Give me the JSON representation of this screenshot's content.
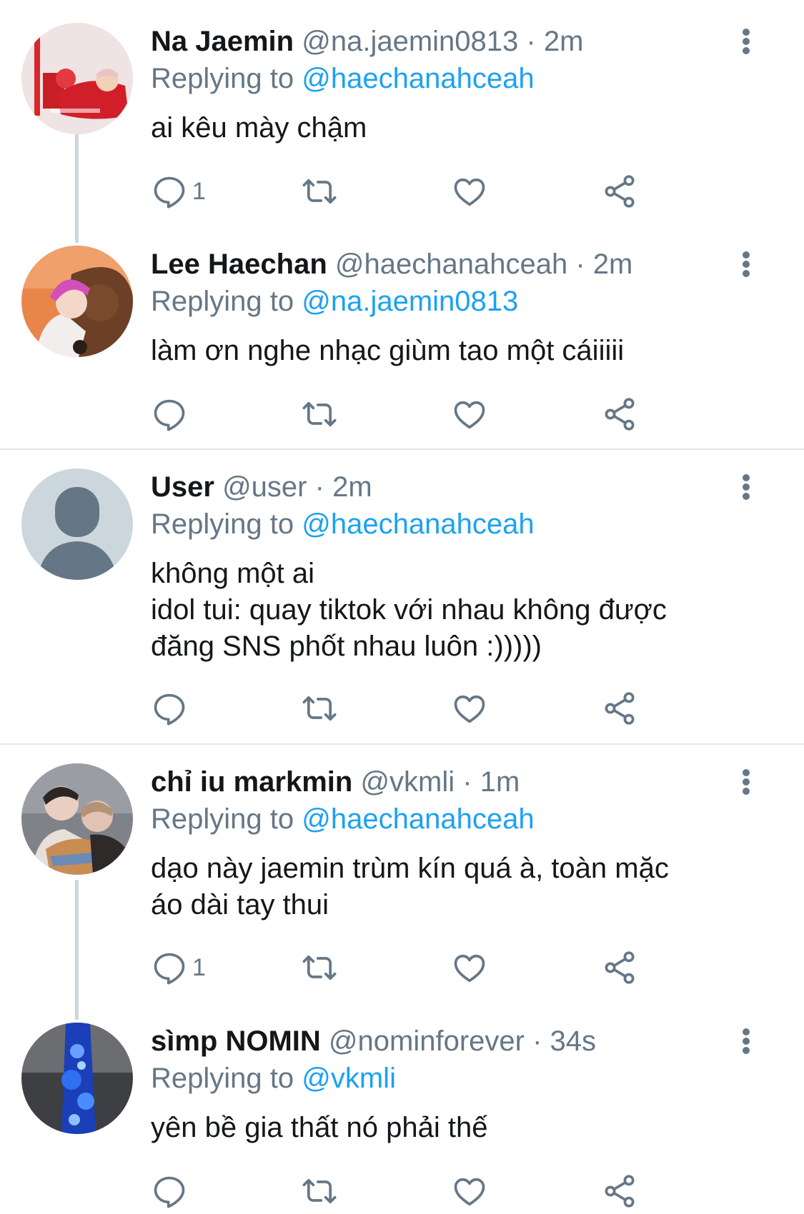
{
  "tweets": [
    {
      "name": "Na Jaemin",
      "handle": "@na.jaemin0813",
      "time": "2m",
      "replying_prefix": "Replying to",
      "replying_to": "@haechanahceah",
      "lines": [
        "ai kêu mày chậm"
      ],
      "reply_count": "1"
    },
    {
      "name": "Lee Haechan",
      "handle": "@haechanahceah",
      "time": "2m",
      "replying_prefix": "Replying to",
      "replying_to": "@na.jaemin0813",
      "lines": [
        "làm ơn nghe nhạc giùm tao một cáiiiii"
      ],
      "reply_count": ""
    },
    {
      "name": "User",
      "handle": "@user",
      "time": "2m",
      "replying_prefix": "Replying to",
      "replying_to": "@haechanahceah",
      "lines": [
        "không một ai",
        "idol tui: quay tiktok với nhau không được",
        "đăng SNS phốt nhau luôn :)))))"
      ],
      "reply_count": ""
    },
    {
      "name": "chỉ iu markmin",
      "handle": "@vkmli",
      "time": "1m",
      "replying_prefix": "Replying to",
      "replying_to": "@haechanahceah",
      "lines": [
        "dạo này jaemin trùm kín quá à, toàn mặc",
        "áo dài tay thui"
      ],
      "reply_count": "1"
    },
    {
      "name": "sìmp NOMIN",
      "handle": "@nominforever",
      "time": "34s",
      "replying_prefix": "Replying to",
      "replying_to": "@vkmli",
      "lines": [
        "yên bề gia thất nó phải thế"
      ],
      "reply_count": ""
    }
  ],
  "dot_separator": "·",
  "icons": [
    "reply-icon",
    "retweet-icon",
    "like-icon",
    "share-icon",
    "more-options-icon"
  ],
  "colors": {
    "link": "#1da1f2",
    "secondary": "#657786",
    "text": "#14171a",
    "thread_line": "#ccd6dd",
    "divider": "#e1e8ed"
  }
}
